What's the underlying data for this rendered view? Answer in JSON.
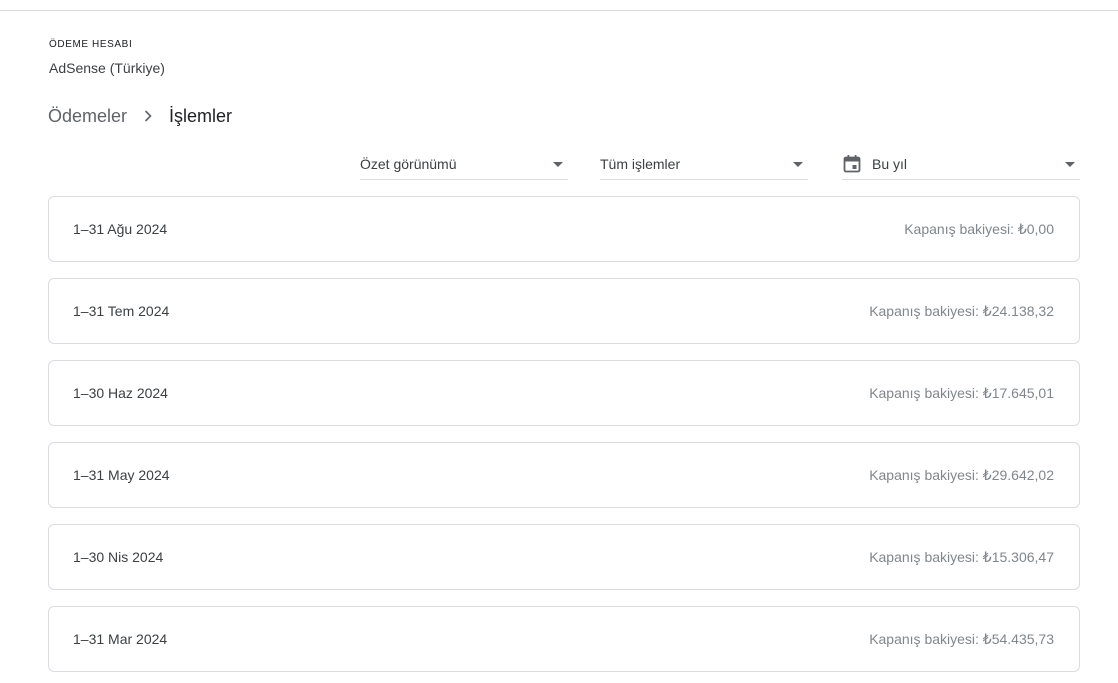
{
  "account": {
    "label": "ÖDEME HESABI",
    "name": "AdSense (Türkiye)"
  },
  "breadcrumb": {
    "parent": "Ödemeler",
    "current": "İşlemler"
  },
  "filters": {
    "view": "Özet görünümü",
    "transactions": "Tüm işlemler",
    "date": "Bu yıl"
  },
  "icons": {
    "separator": "chevron-right-icon",
    "dropdown": "arrow-drop-down-icon",
    "date": "calendar-icon"
  },
  "colors": {
    "border": "#dadce0",
    "text_primary": "#202124",
    "text_secondary": "#3c4043",
    "text_muted": "#80868b"
  },
  "statements": [
    {
      "period": "1–31 Ağu 2024",
      "balance": "Kapanış bakiyesi: ₺0,00"
    },
    {
      "period": "1–31 Tem 2024",
      "balance": "Kapanış bakiyesi: ₺24.138,32"
    },
    {
      "period": "1–30 Haz 2024",
      "balance": "Kapanış bakiyesi: ₺17.645,01"
    },
    {
      "period": "1–31 May 2024",
      "balance": "Kapanış bakiyesi: ₺29.642,02"
    },
    {
      "period": "1–30 Nis 2024",
      "balance": "Kapanış bakiyesi: ₺15.306,47"
    },
    {
      "period": "1–31 Mar 2024",
      "balance": "Kapanış bakiyesi: ₺54.435,73"
    }
  ]
}
